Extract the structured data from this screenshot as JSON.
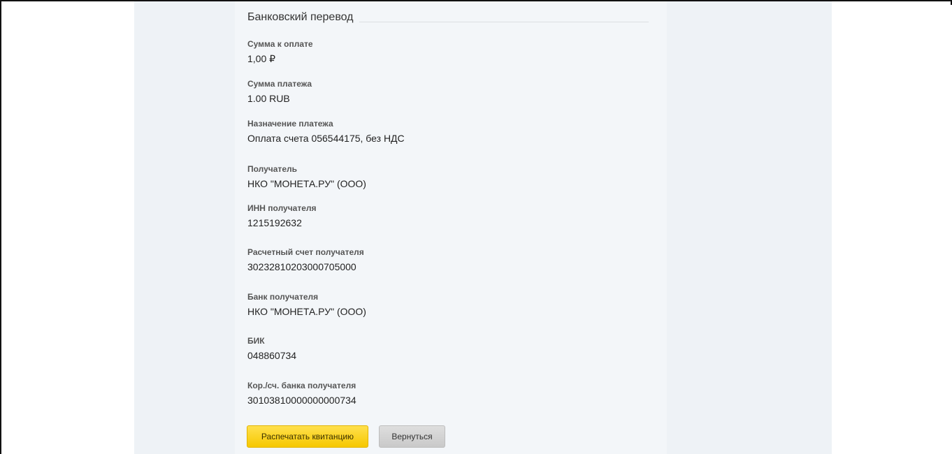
{
  "section": {
    "title": "Банковский перевод"
  },
  "fields": [
    {
      "label": "Сумма к оплате",
      "value": "1,00 ₽"
    },
    {
      "label": "Сумма платежа",
      "value": "1.00 RUB"
    },
    {
      "label": "Назначение платежа",
      "value": "Оплата счета 056544175, без НДС"
    },
    {
      "label": "Получатель",
      "value": "НКО \"МОНЕТА.РУ\" (ООО)"
    },
    {
      "label": "ИНН получателя",
      "value": "1215192632"
    },
    {
      "label": "Расчетный счет получателя",
      "value": "30232810203000705000"
    },
    {
      "label": "Банк получателя",
      "value": "НКО \"МОНЕТА.РУ\" (ООО)"
    },
    {
      "label": "БИК",
      "value": "048860734"
    },
    {
      "label": "Кор./сч. банка получателя",
      "value": "30103810000000000734"
    }
  ],
  "buttons": {
    "print_label": "Распечатать квитанцию",
    "back_label": "Вернуться"
  },
  "colors": {
    "print_button": "#f6c800",
    "back_button": "#c9c9c9",
    "panel_background": "#f3f6f9",
    "outer_background": "#eef2f6"
  }
}
